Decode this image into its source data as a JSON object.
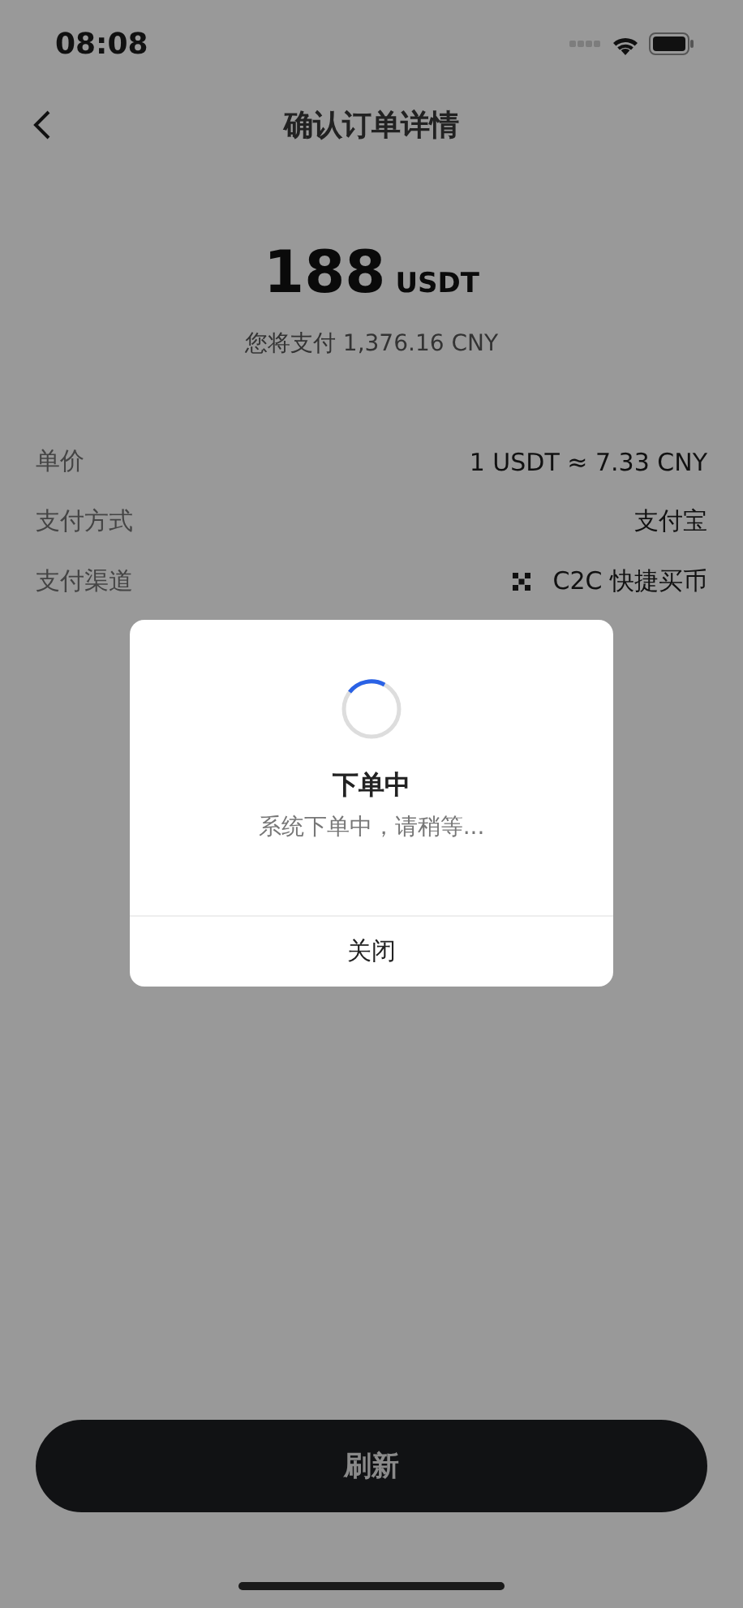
{
  "status_bar": {
    "time": "08:08"
  },
  "nav": {
    "title": "确认订单详情"
  },
  "amount": {
    "value": "188",
    "unit": "USDT",
    "subtitle": "您将支付 1,376.16 CNY"
  },
  "details": [
    {
      "label": "单价",
      "value": "1 USDT ≈ 7.33 CNY",
      "kind": "plain"
    },
    {
      "label": "支付方式",
      "value": "支付宝",
      "kind": "plain"
    },
    {
      "label": "支付渠道",
      "value": "C2C 快捷买币",
      "kind": "channel"
    }
  ],
  "dialog": {
    "title": "下单中",
    "message": "系统下单中，请稍等...",
    "button": "关闭"
  },
  "primary_button": {
    "label": "刷新"
  }
}
